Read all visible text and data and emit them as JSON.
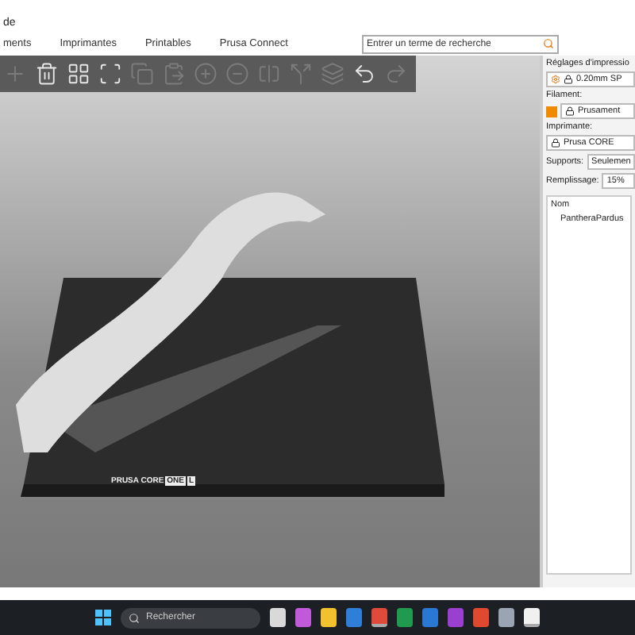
{
  "window": {
    "title": "de"
  },
  "tabs": [
    {
      "label": "ments",
      "selected": false
    },
    {
      "label": "Imprimantes",
      "selected": false
    },
    {
      "label": "Printables",
      "selected": false
    },
    {
      "label": "Prusa Connect",
      "selected": false
    }
  ],
  "search": {
    "placeholder": "Entrer un terme de recherche"
  },
  "toolbar": [
    {
      "kind": "add",
      "disabled": true
    },
    {
      "kind": "delete",
      "disabled": false
    },
    {
      "kind": "arrange",
      "disabled": false
    },
    {
      "kind": "arrange-selection",
      "disabled": false
    },
    {
      "kind": "copy",
      "disabled": true
    },
    {
      "kind": "paste",
      "disabled": true
    },
    {
      "kind": "add-instance",
      "disabled": true
    },
    {
      "kind": "remove-instance",
      "disabled": true
    },
    {
      "kind": "split-objects",
      "disabled": true
    },
    {
      "kind": "split-parts",
      "disabled": true
    },
    {
      "kind": "layers",
      "disabled": true
    },
    {
      "kind": "undo",
      "disabled": false
    },
    {
      "kind": "redo",
      "disabled": true
    }
  ],
  "bed": {
    "logo_left": "PRUSA CORE",
    "logo_mid": "ONE",
    "logo_right": "L"
  },
  "sidebar": {
    "print_label": "Réglages d'impressio",
    "print_preset": "0.20mm SP",
    "filament": {
      "label": "Filament:",
      "preset": "Prusament",
      "color": "#f08a00"
    },
    "printer_label": "Imprimante:",
    "printer_preset": "Prusa CORE",
    "supports_label": "Supports:",
    "supports_value": "Seulemen",
    "infill_label": "Remplissage:",
    "infill_value": "15%",
    "list_header": "Nom",
    "objects": [
      {
        "name": "PantheraPardus",
        "selected": false
      }
    ]
  },
  "taskbar": {
    "search": "Rechercher",
    "apps": [
      {
        "color": "#d9d9d9",
        "running": false
      },
      {
        "color": "#c05ad8",
        "running": false
      },
      {
        "color": "#f2c12e",
        "running": false
      },
      {
        "color": "#2f7fd8",
        "running": false
      },
      {
        "color": "#e04a3a",
        "running": true
      },
      {
        "color": "#1f9a4e",
        "running": false
      },
      {
        "color": "#2a78d4",
        "running": false
      },
      {
        "color": "#9b3fd0",
        "running": false
      },
      {
        "color": "#e0492f",
        "running": false
      },
      {
        "color": "#9aa4b2",
        "running": false
      },
      {
        "color": "#f0f0f0",
        "running": true
      }
    ]
  }
}
